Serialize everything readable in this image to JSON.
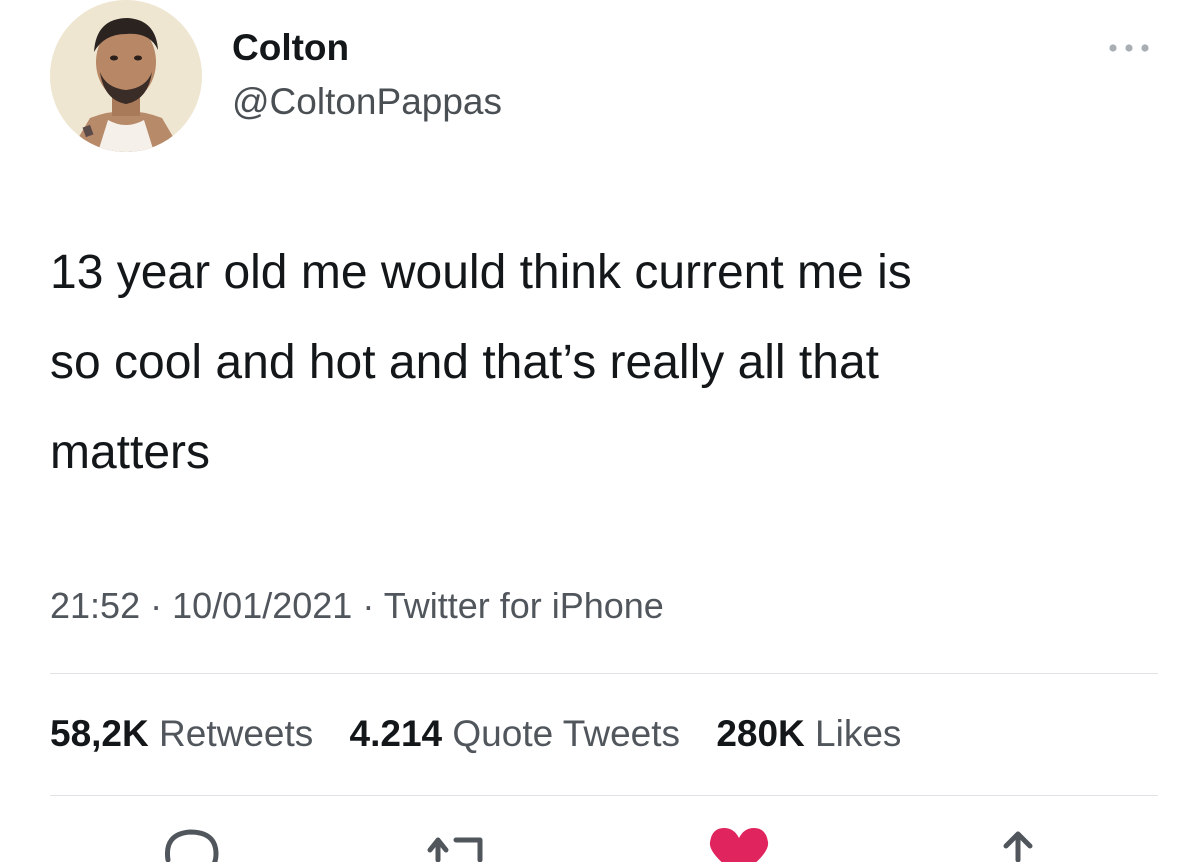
{
  "tweet": {
    "author_name": "Colton",
    "author_handle": "@ColtonPappas",
    "text_lines": [
      "13 year old me would think current me is",
      "so cool and hot and that’s really all that",
      "matters"
    ],
    "time": "21:52",
    "date": "10/01/2021",
    "separator": "·",
    "source": "Twitter for iPhone"
  },
  "stats": {
    "retweets_count": "58,2K",
    "retweets_label": "Retweets",
    "quotes_count": "4.214",
    "quotes_label": "Quote Tweets",
    "likes_count": "280K",
    "likes_label": "Likes"
  },
  "icons": {
    "more": "more-icon",
    "reply": "reply-icon",
    "retweet": "retweet-icon",
    "like": "heart-icon",
    "share": "share-icon"
  },
  "colors": {
    "like_active": "#e0245e",
    "text_primary": "#14171a",
    "text_secondary": "#50565c"
  }
}
